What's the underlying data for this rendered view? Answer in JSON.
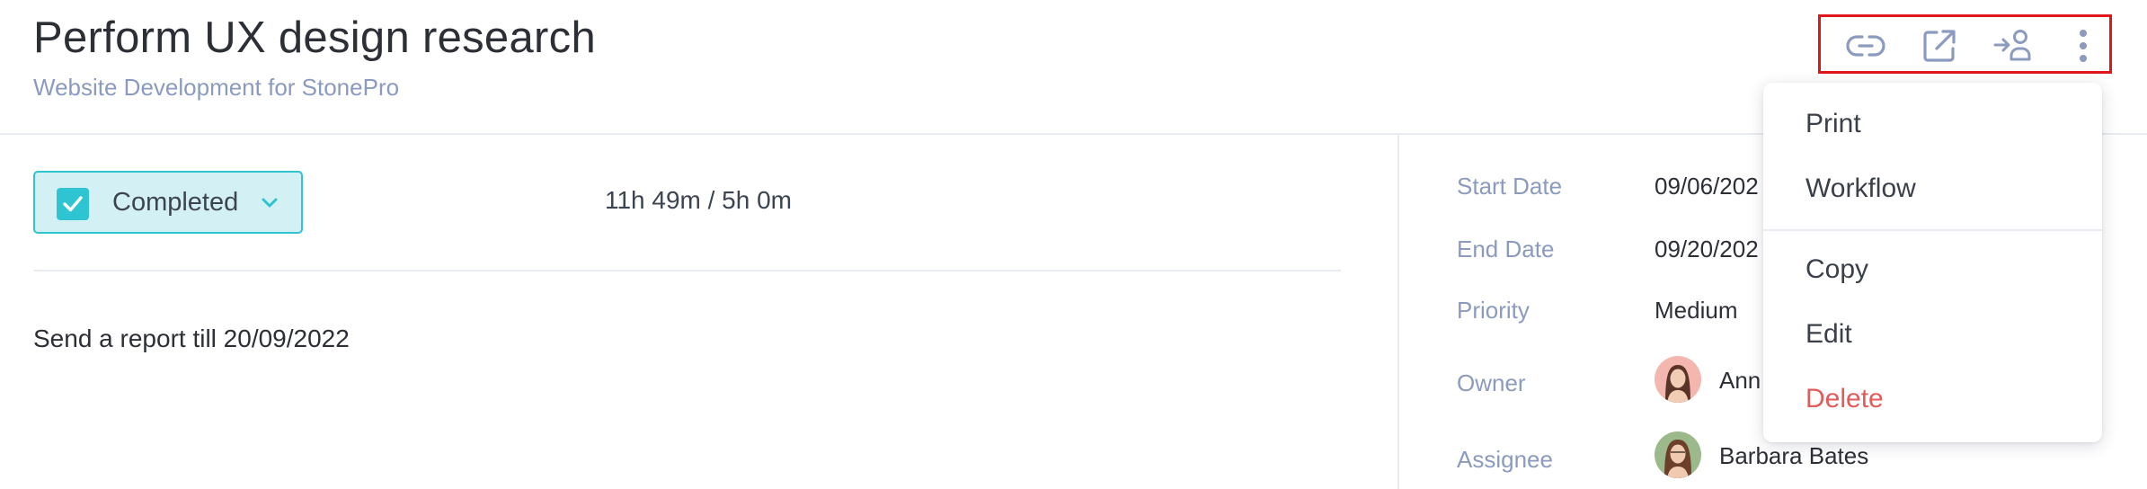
{
  "task": {
    "title": "Perform UX design research",
    "project": "Website Development for StonePro",
    "status": "Completed",
    "time_tracked": "11h 49m / 5h 0m",
    "description": "Send a report till 20/09/2022"
  },
  "toolbar": {
    "icons": [
      "link-icon",
      "open-external-icon",
      "assign-user-icon",
      "more-vertical-icon"
    ]
  },
  "details": {
    "start_date_label": "Start Date",
    "start_date_value": "09/06/202",
    "end_date_label": "End Date",
    "end_date_value": "09/20/202",
    "priority_label": "Priority",
    "priority_value": "Medium",
    "owner_label": "Owner",
    "owner_name": "Ann",
    "assignee_label": "Assignee",
    "assignee_name": "Barbara Bates"
  },
  "menu": {
    "items": [
      {
        "label": "Print"
      },
      {
        "label": "Workflow"
      },
      {
        "label": "Copy"
      },
      {
        "label": "Edit"
      },
      {
        "label": "Delete"
      }
    ]
  },
  "colors": {
    "accent": "#2fc4d2",
    "status_bg": "#d3f1f5",
    "muted_text": "#8b9bbf",
    "danger": "#e35a5a",
    "highlight_border": "#e0161b"
  }
}
